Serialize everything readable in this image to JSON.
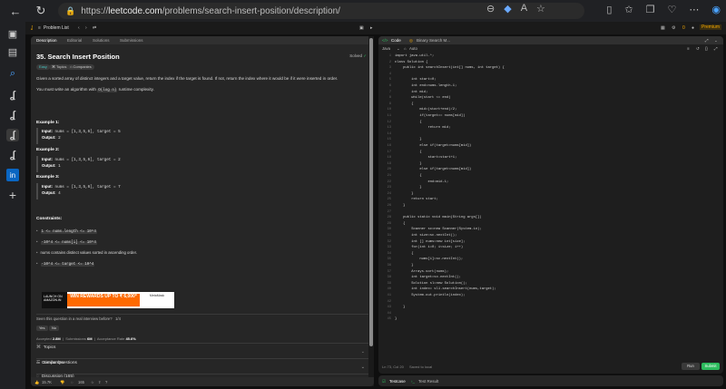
{
  "browser": {
    "url_prefix": "https://",
    "url_host": "leetcode.com",
    "url_path": "/problems/search-insert-position/description/"
  },
  "topbar": {
    "problem_list": "Problem List",
    "premium": "Premium"
  },
  "left_tabs": [
    "Description",
    "Editorial",
    "Solutions",
    "Submissions"
  ],
  "problem": {
    "title": "35. Search Insert Position",
    "solved_label": "Solved",
    "difficulty": "Easy",
    "topics_label": "Topics",
    "companies_label": "Companies",
    "desc1": "Given a sorted array of distinct integers and a target value, return the index if the target is found. If not, return the index where it would be if it were inserted in order.",
    "desc2_pre": "You must write an algorithm with",
    "desc2_code": "O(log n)",
    "desc2_post": "runtime complexity.",
    "examples": [
      {
        "heading": "Example 1:",
        "input": "nums = [1,3,5,6], target = 5",
        "output": "2"
      },
      {
        "heading": "Example 2:",
        "input": "nums = [1,3,5,6], target = 2",
        "output": "1"
      },
      {
        "heading": "Example 3:",
        "input": "nums = [1,3,5,6], target = 7",
        "output": "4"
      }
    ],
    "input_label": "Input:",
    "output_label": "Output:",
    "constraints_heading": "Constraints:",
    "constraints": [
      "1 <= nums.length <= 10^4",
      "-10^4 <= nums[i] <= 10^4",
      "nums contains distinct values sorted in ascending order.",
      "-10^4 <= target <= 10^4"
    ],
    "ad": {
      "left": "LAUNCH ON AMAZON.IN",
      "main": "WIN REWARDS UP TO ₹ 6,000*",
      "right": "MetaMask"
    },
    "interview_q": "Seen this question in a real interview before?",
    "interview_count": "1/4",
    "yes": "Yes",
    "no": "No",
    "accepted_label": "Accepted",
    "accepted_value": "2.8M",
    "submissions_label": "Submissions",
    "submissions_value": "6M",
    "acceptance_label": "Acceptance Rate",
    "acceptance_value": "45.6%",
    "accordions": [
      "Topics",
      "Companies",
      "Similar Questions",
      "Discussion (165)"
    ],
    "likes": "15.7K",
    "comments": "165"
  },
  "right_tabs": {
    "code": "Code",
    "second": "Binary Search M..."
  },
  "lang": {
    "name": "Java",
    "mode": "Auto"
  },
  "code_lines": [
    "import java.util.*;",
    "class Solution {",
    "    public int searchInsert(int[] nums, int target) {",
    "",
    "        int start=0;",
    "        int end=nums.length-1;",
    "        int mid;",
    "        while(start <= end)",
    "        {",
    "            mid=(start+end)/2;",
    "            if(target== nums[mid])",
    "            {",
    "                return mid;",
    "",
    "            }",
    "            else if(target>nums[mid])",
    "            {",
    "                start=start+1;",
    "            }",
    "            else if(target<nums[mid])",
    "            {",
    "                end=mid-1;",
    "            }",
    "        }",
    "        return start;",
    "    }",
    "",
    "    public static void main(String args[])",
    "    {",
    "        Scanner sc=new Scanner(System.in);",
    "        int size=sc.nextInt();",
    "        int [] nums=new int[size];",
    "        for(int i=0; i<size; i++)",
    "        {",
    "            nums[i]=sc.nextInt();",
    "        }",
    "        Arrays.sort(nums);",
    "        int target=sc.nextInt();",
    "        Solution sl=new Solution();",
    "        int index= sl1.searchInsert(nums,target);",
    "        System.out.println(index);",
    "",
    "    }",
    "",
    "}"
  ],
  "footer": {
    "position": "Ln 73, Col 20",
    "saved": "Saved to local",
    "run": "Run",
    "submit": "Submit"
  },
  "test": {
    "testcase": "Testcase",
    "result": "Test Result"
  }
}
